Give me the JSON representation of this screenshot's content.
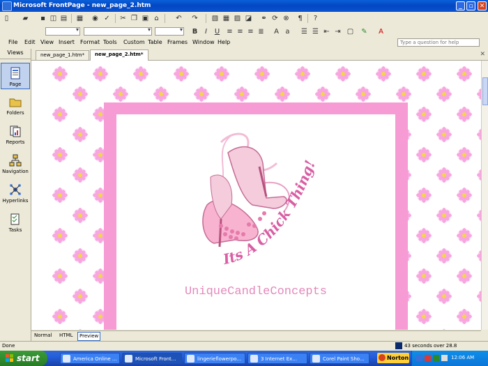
{
  "app": {
    "title": "Microsoft FrontPage - new_page_2.htm"
  },
  "menu": [
    "File",
    "Edit",
    "View",
    "Insert",
    "Format",
    "Tools",
    "Custom",
    "Table",
    "Frames",
    "Window",
    "Help"
  ],
  "ask": {
    "placeholder": "Type a question for help"
  },
  "views": {
    "header": "Views",
    "items": [
      {
        "label": "Page",
        "icon": "page-view-icon",
        "selected": true
      },
      {
        "label": "Folders",
        "icon": "folders-view-icon",
        "selected": false
      },
      {
        "label": "Reports",
        "icon": "reports-view-icon",
        "selected": false
      },
      {
        "label": "Navigation",
        "icon": "navigation-view-icon",
        "selected": false
      },
      {
        "label": "Hyperlinks",
        "icon": "hyperlinks-view-icon",
        "selected": false
      },
      {
        "label": "Tasks",
        "icon": "tasks-view-icon",
        "selected": false
      }
    ]
  },
  "tabs": [
    {
      "label": "new_page_1.htm*",
      "active": false
    },
    {
      "label": "new_page_2.htm*",
      "active": true
    }
  ],
  "page": {
    "banner_text": "Its A Chick Thing!",
    "brand_text": "UniqueCandleConcepts",
    "frame_color": "#f79bd4",
    "flower_color": "#f9a9e6"
  },
  "view_tabs": [
    {
      "label": "Normal",
      "selected": false
    },
    {
      "label": "HTML",
      "selected": false
    },
    {
      "label": "Preview",
      "selected": true
    }
  ],
  "status": {
    "left": "Done",
    "right": "43 seconds over 28.8"
  },
  "taskbar": {
    "start_label": "start",
    "buttons": [
      {
        "label": "America Online ...",
        "active": false
      },
      {
        "label": "Microsoft Front...",
        "active": true
      },
      {
        "label": "lingerieflowerpo...",
        "active": false
      },
      {
        "label": "3 Internet Ex...",
        "active": false
      },
      {
        "label": "Corel Paint Sho...",
        "active": false
      }
    ],
    "norton_label": "Norton",
    "clock": "12:06 AM"
  }
}
